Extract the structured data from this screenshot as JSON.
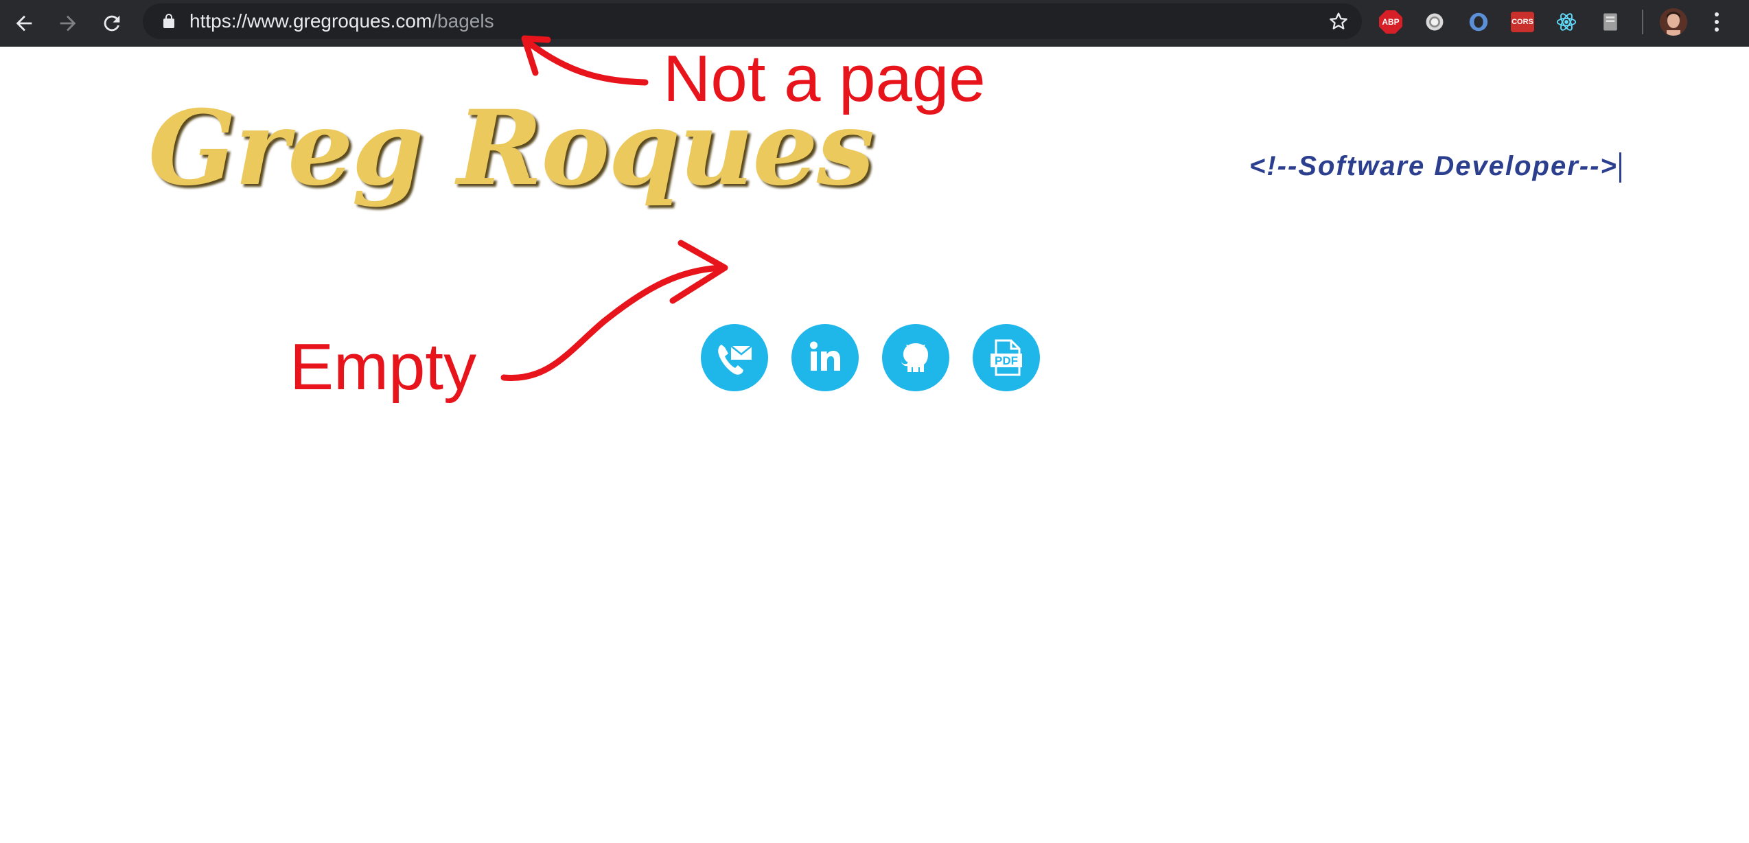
{
  "browser": {
    "url_host": "https://www.gregroques.com",
    "url_path": "/bagels",
    "icons": {
      "back": "arrow-left-icon",
      "forward": "arrow-right-icon",
      "reload": "reload-icon",
      "lock": "lock-icon",
      "bookmark": "star-icon",
      "menu": "kebab-menu-icon"
    },
    "extensions": [
      {
        "name": "adblock-plus",
        "label": "ABP"
      },
      {
        "name": "extension-circle",
        "label": ""
      },
      {
        "name": "extension-ring",
        "label": ""
      },
      {
        "name": "cors-extension",
        "label": "CORS"
      },
      {
        "name": "react-devtools",
        "label": ""
      },
      {
        "name": "extension-document",
        "label": ""
      }
    ]
  },
  "site": {
    "logo_text": "Greg Roques",
    "tagline": "<!--Software Developer-->",
    "logo_color": "#ecc95c",
    "tagline_color": "#2c3f8f",
    "social_color": "#1fb6ea",
    "social_links": [
      {
        "name": "contact",
        "icon": "phone-mail-icon"
      },
      {
        "name": "linkedin",
        "icon": "linkedin-icon",
        "label": "in"
      },
      {
        "name": "github",
        "icon": "github-icon"
      },
      {
        "name": "resume",
        "icon": "pdf-icon",
        "label": "PDF"
      }
    ]
  },
  "annotations": {
    "not_a_page": "Not a page",
    "empty": "Empty",
    "color": "#e8141b"
  }
}
